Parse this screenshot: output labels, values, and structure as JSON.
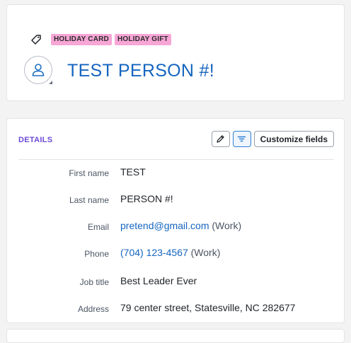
{
  "header": {
    "tags": [
      "HOLIDAY CARD",
      "HOLIDAY GIFT"
    ],
    "name": "TEST PERSON #!"
  },
  "details": {
    "title": "DETAILS",
    "customize_label": "Customize fields",
    "fields": [
      {
        "label": "First name",
        "value": "TEST"
      },
      {
        "label": "Last name",
        "value": "PERSON #!"
      },
      {
        "label": "Email",
        "value": "pretend@gmail.com",
        "suffix": "(Work)"
      },
      {
        "label": "Phone",
        "value": "(704) 123-4567",
        "suffix": "(Work)"
      },
      {
        "label": "Job title",
        "value": "Best Leader Ever"
      },
      {
        "label": "Address",
        "value": "79 center street, Statesville, NC 282677"
      }
    ]
  },
  "colors": {
    "accent_blue": "#1565c0",
    "tag_pink": "#f7a6d6",
    "section_purple": "#6c4bd6"
  }
}
